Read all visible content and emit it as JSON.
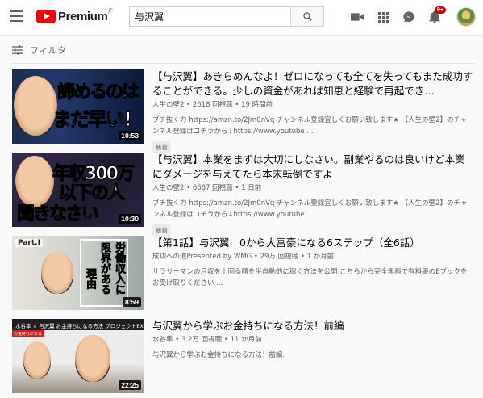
{
  "header": {
    "logo_text": "Premium",
    "logo_region": "JP",
    "search_value": "与沢翼",
    "notification_count": "9+"
  },
  "filter": {
    "label": "フィルタ"
  },
  "results": [
    {
      "title": "【与沢翼】あきらめんなよ！ゼロになっても全てを失ってもまた成功することができる。少しの資金があれば知恵と経験で再起でき…",
      "channel": "人生の壁2",
      "views": "2618 回視聴",
      "age": "19 時間前",
      "description": "ブチ抜く力 https://amzn.to/2Jm0nVq チャンネル登録宜しくお願い致します★ 【人生の壁2】のチャンネル登録はコチラから↓https://www.youtube ...",
      "badge": "新着",
      "duration": "10:53",
      "thumb_line1": "諦めるのは",
      "thumb_line2": "まだ早い!"
    },
    {
      "title": "【与沢翼】本業をまずは大切にしなさい。副業やるのは良いけど本業にダメージを与えてたら本末転倒ですよ",
      "channel": "人生の壁2",
      "views": "6667 回視聴",
      "age": "1 日前",
      "description": "ブチ抜く力 https://amzn.to/2Jm0nVq チャンネル登録宜しくお願い致します★ 【人生の壁2】のチャンネル登録はコチラから↓https://www.youtube ...",
      "badge": "新着",
      "duration": "10:30",
      "thumb_line1": "年収300万",
      "thumb_line2": "以下の人",
      "thumb_line3": "聞きなさい"
    },
    {
      "title": "【第1話】与沢翼　0から大富豪になる6ステップ（全6話）",
      "channel": "成功への道Presented by WMG",
      "views": "29万 回視聴",
      "age": "1 か月前",
      "description": "サラリーマンの月収を上回る額を半自動的に稼ぐ方法を公開 こちらから完全無料で有料級のEブックをお受け取りください ...",
      "duration": "8:59",
      "thumb_part": "Part.Ⅰ",
      "thumb_v1": "労働収入に",
      "thumb_v2": "限界がある",
      "thumb_v3": "理由"
    },
    {
      "title": "与沢翼から学ぶお金持ちになる方法！前編",
      "channel": "水谷隼",
      "views": "3.2万 回視聴",
      "age": "11 か月前",
      "description": "与沢翼から学ぶお金持ちになる方法！前編.",
      "duration": "22:25",
      "thumb_banner": "水谷隼 × 与沢翼 お金持ちになる方法 プロジェクトEX",
      "thumb_red": "お金持ちになる方法"
    }
  ]
}
